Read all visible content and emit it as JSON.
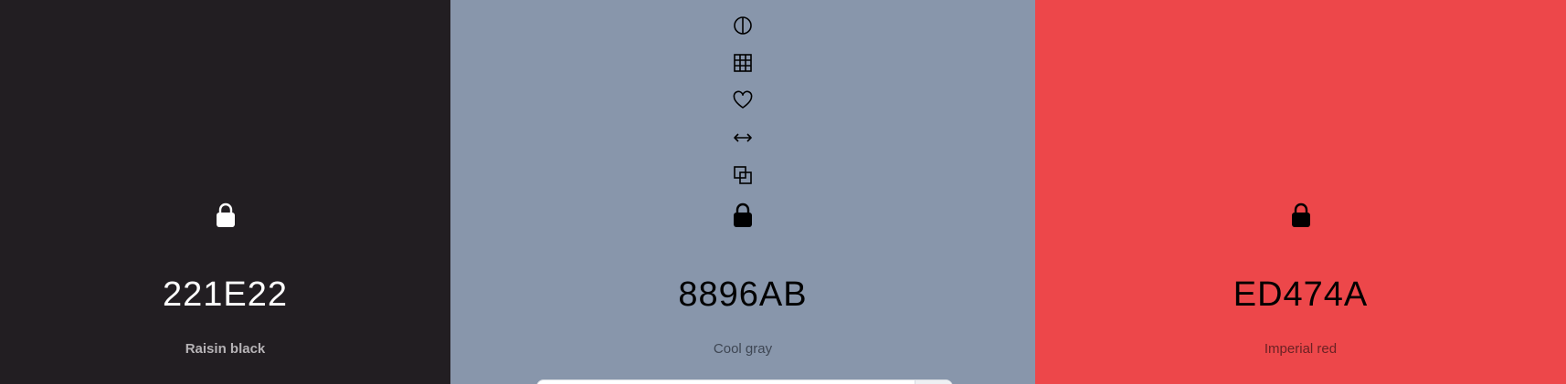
{
  "swatches": [
    {
      "hex": "221E22",
      "name": "Raisin black",
      "color": "#221E22",
      "text_color": "#FFFFFF",
      "locked": true
    },
    {
      "hex": "8896AB",
      "name": "Cool gray",
      "color": "#8896AB",
      "text_color": "#000000",
      "locked": true,
      "tools": [
        "contrast-icon",
        "grid-icon",
        "heart-icon",
        "arrows-horizontal-icon",
        "copy-icon"
      ]
    },
    {
      "hex": "ED474A",
      "name": "Imperial red",
      "color": "#ED474A",
      "text_color": "#000000",
      "locked": true
    }
  ]
}
